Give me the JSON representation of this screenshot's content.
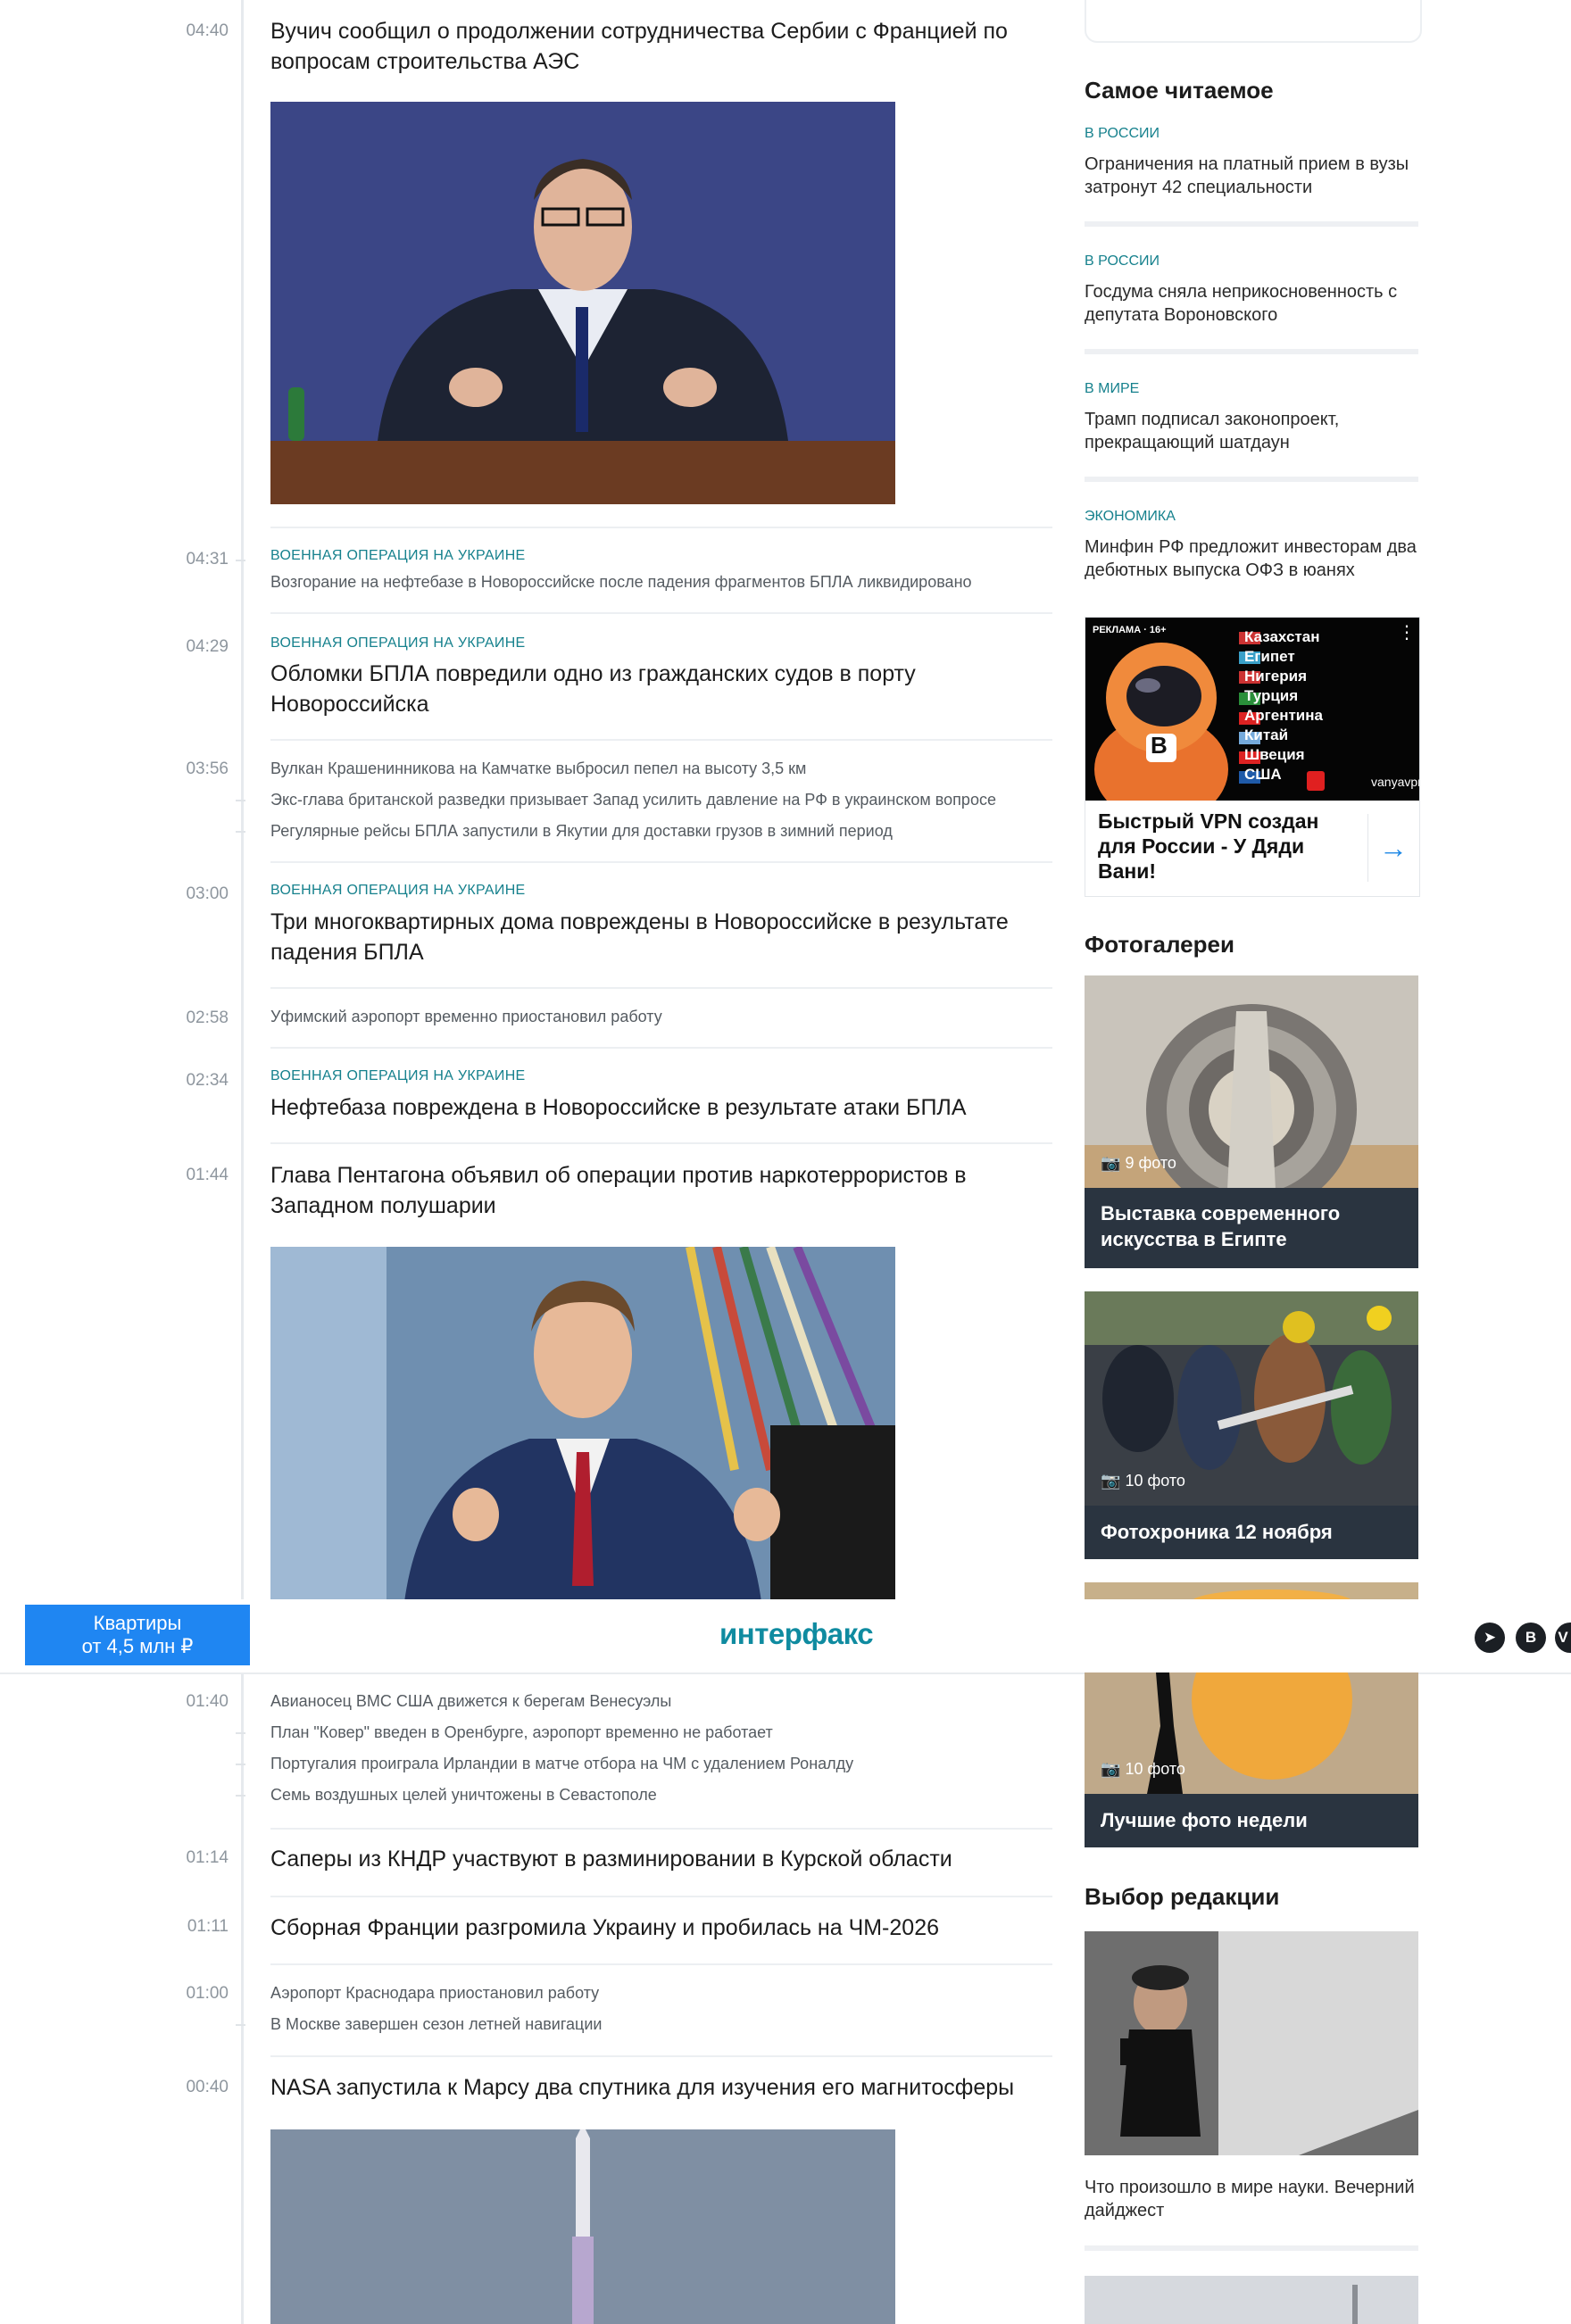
{
  "feed": [
    {
      "time": "04:40",
      "headline": "Вучич сообщил о продолжении сотрудничества Сербии с Францией по вопросам строительства АЭС"
    },
    {
      "time": "04:31",
      "rubric": "ВОЕННАЯ ОПЕРАЦИЯ НА УКРАИНЕ",
      "small": "Возгорание на нефтебазе в Новороссийске после падения фрагментов БПЛА ликвидировано"
    },
    {
      "time": "04:29",
      "rubric": "ВОЕННАЯ ОПЕРАЦИЯ НА УКРАИНЕ",
      "headline": "Обломки БПЛА повредили одно из гражданских судов в порту Новороссийска"
    },
    {
      "time": "03:56",
      "smalls": [
        "Вулкан Крашенинникова на Камчатке выбросил пепел на высоту 3,5 км",
        "Экс-глава британской разведки призывает Запад усилить давление на РФ в украинском вопросе",
        "Регулярные рейсы БПЛА запустили в Якутии для доставки грузов в зимний период"
      ]
    },
    {
      "time": "03:00",
      "rubric": "ВОЕННАЯ ОПЕРАЦИЯ НА УКРАИНЕ",
      "headline": "Три многоквартирных дома повреждены в Новороссийске в результате падения БПЛА"
    },
    {
      "time": "02:58",
      "small": "Уфимский аэропорт временно приостановил работу"
    },
    {
      "time": "02:34",
      "rubric": "ВОЕННАЯ ОПЕРАЦИЯ НА УКРАИНЕ",
      "headline": "Нефтебаза повреждена в Новороссийске в результате атаки БПЛА"
    },
    {
      "time": "01:44",
      "headline": "Глава Пентагона объявил об операции против наркотеррористов в Западном полушарии"
    },
    {
      "time": "01:40",
      "smalls": [
        "Авианосец ВМС США движется к берегам Венесуэлы",
        "План \"Ковер\" введен в Оренбурге, аэропорт временно не работает",
        "Португалия проиграла Ирландии в матче отбора на ЧМ с удалением Роналду",
        "Семь воздушных целей уничтожены в Севастополе"
      ]
    },
    {
      "time": "01:14",
      "headline": "Саперы из КНДР участвуют в разминировании в Курской области"
    },
    {
      "time": "01:11",
      "headline": "Сборная Франции разгромила Украину и пробилась на ЧМ-2026"
    },
    {
      "time": "01:00",
      "smalls": [
        "Аэропорт Краснодара приостановил работу",
        "В Москве завершен сезон летней навигации"
      ]
    },
    {
      "time": "00:40",
      "headline": "NASA запустила к Марсу два спутника для изучения его магнитосферы"
    }
  ],
  "most_read": {
    "title": "Самое читаемое",
    "items": [
      {
        "rubric": "В РОССИИ",
        "text": "Ограничения на платный прием в вузы затронут 42 специальности"
      },
      {
        "rubric": "В РОССИИ",
        "text": "Госдума сняла неприкосновенность с депутата Вороновского"
      },
      {
        "rubric": "В МИРЕ",
        "text": "Трамп подписал законопроект, прекращающий шатдаун"
      },
      {
        "rubric": "ЭКОНОМИКА",
        "text": "Минфин РФ предложит инвесторам два дебютных выпуска ОФЗ в юанях"
      }
    ]
  },
  "ad": {
    "label": "РЕКЛАМА · 16+",
    "countries": [
      "Казахстан",
      "Египет",
      "Нигерия",
      "Турция",
      "Аргентина",
      "Китай",
      "Швеция",
      "США"
    ],
    "domain": "vanyavpn.ag",
    "title": "Быстрый VPN создан для России - У Дяди Вани!",
    "arrow": "→",
    "badge": "B",
    "menu": "⋮"
  },
  "galleries": {
    "title": "Фотогалереи",
    "items": [
      {
        "count": "9 фото",
        "caption_line1": "Выставка современного",
        "caption_line2": "искусства в Египте"
      },
      {
        "count": "10 фото",
        "caption_line1": "Фотохроника 12 ноября",
        "caption_line2": ""
      },
      {
        "count": "10 фото",
        "caption_line1": "Лучшие фото недели",
        "caption_line2": ""
      }
    ]
  },
  "editors_choice": {
    "title": "Выбор редакции",
    "text": "Что произошло в мире науки. Вечерний дайджест"
  },
  "sticky": {
    "promo_line1": "Квартиры",
    "promo_line2": "от 4,5 млн ₽",
    "logo": "интерфакс",
    "social": [
      "➤",
      "В",
      "V"
    ]
  }
}
